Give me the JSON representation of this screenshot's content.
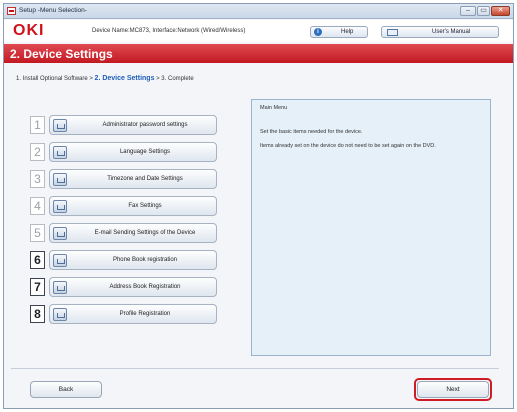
{
  "window": {
    "title": "Setup -Menu Selection-",
    "controls": {
      "minimize": "–",
      "maximize": "▭",
      "close": "✕"
    }
  },
  "toolbar": {
    "logo": "OKI",
    "device_name": "Device Name:MC873, Interface:Network (Wired/Wireless)",
    "help_label": "Help",
    "manual_label": "User's Manual"
  },
  "header": {
    "title": "2. Device Settings"
  },
  "breadcrumb": {
    "step1": "1. Install Optional Software  >",
    "current": "2. Device Settings",
    "step3": "> 3. Complete"
  },
  "steps": [
    {
      "num": "1",
      "label": "Administrator password settings",
      "active": false
    },
    {
      "num": "2",
      "label": "Language Settings",
      "active": false
    },
    {
      "num": "3",
      "label": "Timezone and Date Settings",
      "active": false
    },
    {
      "num": "4",
      "label": "Fax Settings",
      "active": false
    },
    {
      "num": "5",
      "label": "E-mail Sending Settings of the Device",
      "active": false
    },
    {
      "num": "6",
      "label": "Phone Book registration",
      "active": true
    },
    {
      "num": "7",
      "label": "Address Book Registration",
      "active": true
    },
    {
      "num": "8",
      "label": "Profile Registration",
      "active": true
    }
  ],
  "info": {
    "title": "Main Menu",
    "line1": "Set the basic items needed for the device.",
    "line2": "Items already set on the device do not need to be set again on the DVD."
  },
  "footer": {
    "back_label": "Back",
    "next_label": "Next"
  },
  "colors": {
    "brand_red": "#d0121b",
    "header_red": "#c21922",
    "link_blue": "#1e5fb8",
    "panel_bg": "#e5f0f9"
  }
}
